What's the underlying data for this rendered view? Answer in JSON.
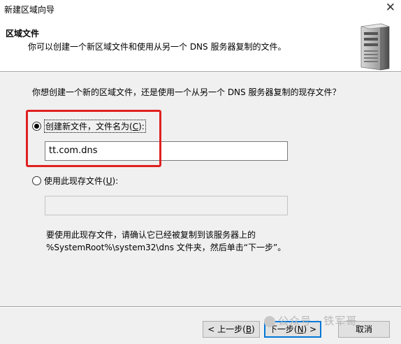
{
  "window": {
    "title": "新建区域向导",
    "close_glyph": "✕"
  },
  "header": {
    "title": "区域文件",
    "subtitle": "你可以创建一个新区域文件和使用从另一个 DNS 服务器复制的文件。",
    "icon": "server-icon"
  },
  "main": {
    "question": "你想创建一个新的区域文件，还是使用一个从另一个 DNS 服务器复制的现存文件？",
    "option_new": {
      "label_before": "创建新文件，文件名为(",
      "accel": "C",
      "label_after": "):",
      "selected": true
    },
    "new_file_value": "tt.com.dns",
    "option_existing": {
      "label_before": "使用此现存文件(",
      "accel": "U",
      "label_after": "):",
      "selected": false
    },
    "existing_file_value": "",
    "note_line1": "要使用此现存文件，请确认它已经被复制到该服务器上的",
    "note_line2": "%SystemRoot%\\system32\\dns 文件夹，然后单击“下一步”。"
  },
  "footer": {
    "back_before": "< 上一步(",
    "back_accel": "B",
    "back_after": ")",
    "next_before": "下一步(",
    "next_accel": "N",
    "next_after": ") >",
    "cancel": "取消"
  },
  "watermark": "公众号 · 铁军哥",
  "annotation_color": "#e02020"
}
